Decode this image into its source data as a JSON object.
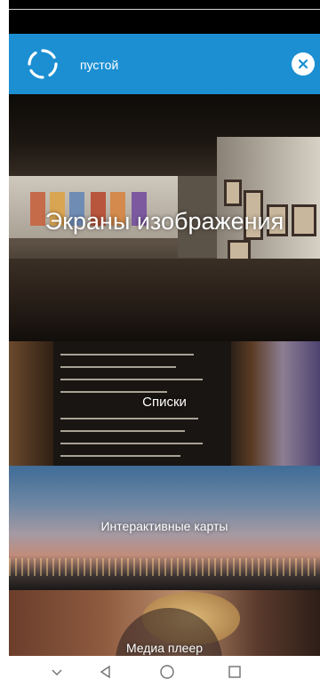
{
  "header": {
    "title": "пустой",
    "logo_icon": "loading-ring-icon",
    "close_icon": "close-icon",
    "background_color": "#1b8fd2"
  },
  "tiles": [
    {
      "label": "Экраны изображения",
      "image": "art-gallery-photo"
    },
    {
      "label": "Списки",
      "image": "chalkboard-menu-photo"
    },
    {
      "label": "Интерактивные карты",
      "image": "city-skyline-photo"
    },
    {
      "label": "Медиа плеер",
      "image": "woman-portrait-photo"
    }
  ],
  "navbar": {
    "icons": [
      "chevron-down-icon",
      "back-triangle-icon",
      "home-circle-icon",
      "recents-square-icon"
    ]
  }
}
